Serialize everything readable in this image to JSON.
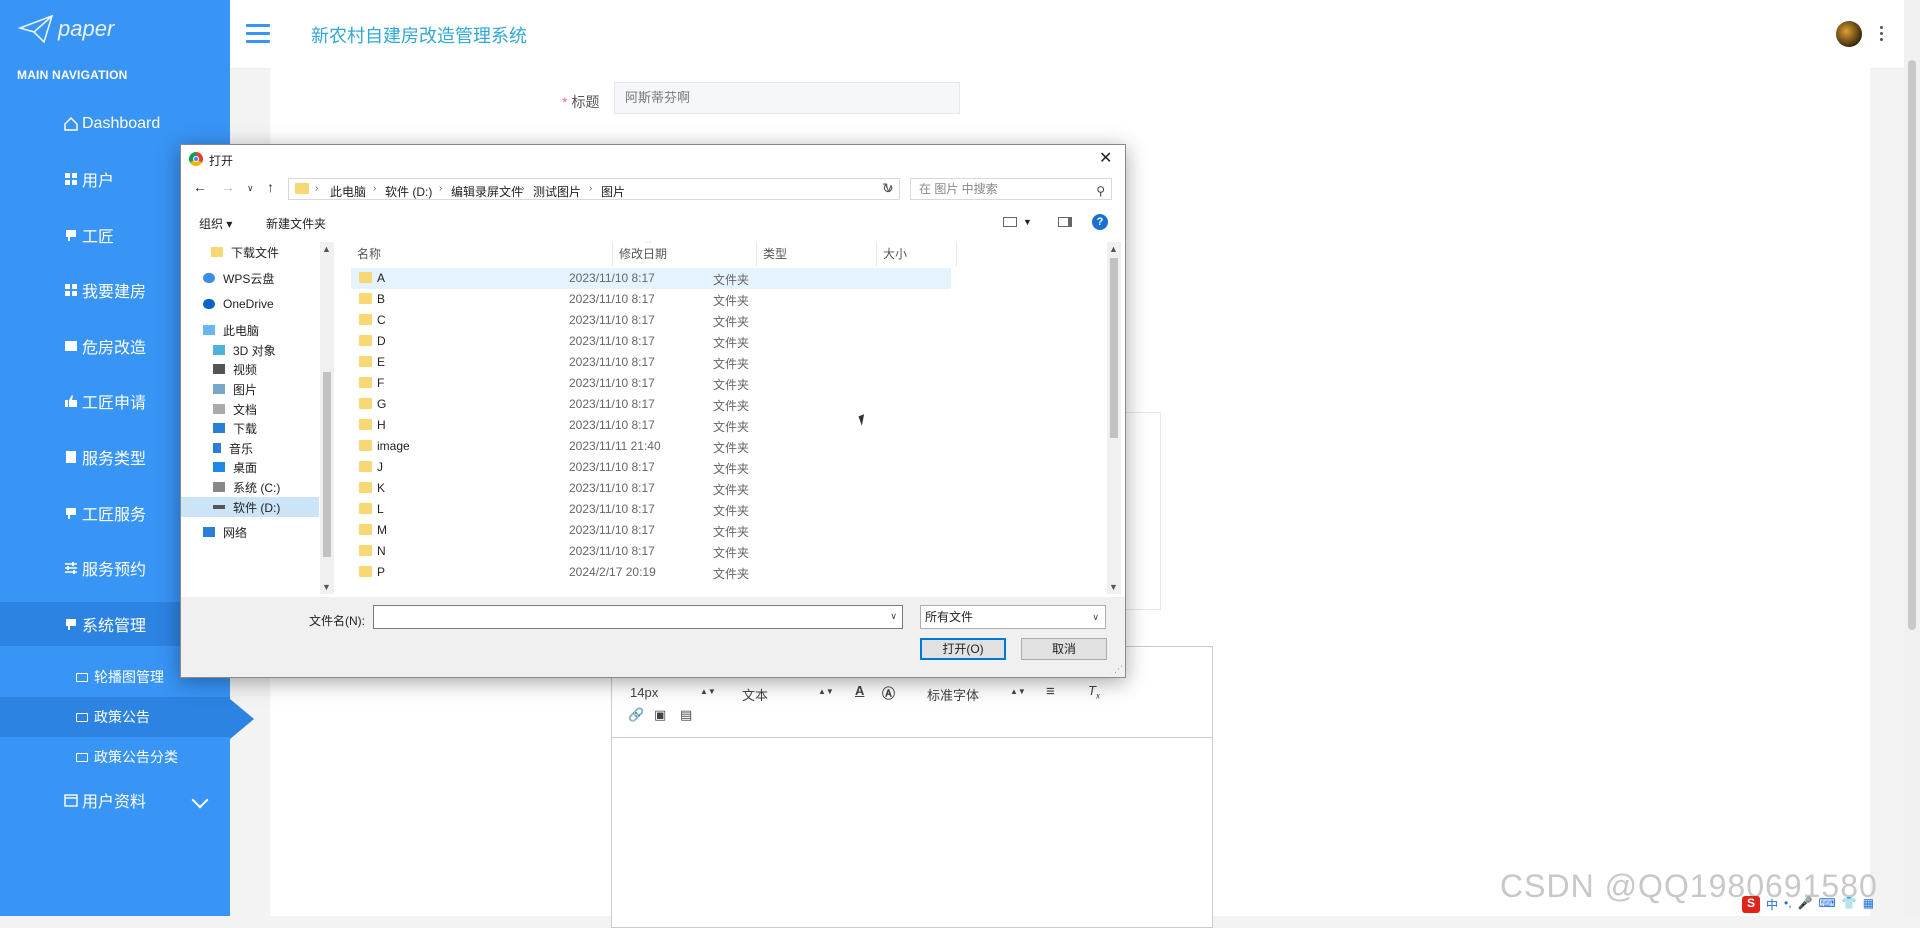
{
  "sidebar": {
    "logo_text": "paper",
    "section_label": "MAIN NAVIGATION",
    "items": [
      {
        "label": "Dashboard"
      },
      {
        "label": "用户"
      },
      {
        "label": "工匠"
      },
      {
        "label": "我要建房"
      },
      {
        "label": "危房改造"
      },
      {
        "label": "工匠申请"
      },
      {
        "label": "服务类型"
      },
      {
        "label": "工匠服务"
      },
      {
        "label": "服务预约"
      },
      {
        "label": "系统管理"
      }
    ],
    "sub_items": [
      {
        "label": "轮播图管理"
      },
      {
        "label": "政策公告"
      },
      {
        "label": "政策公告分类"
      }
    ],
    "bottom_item": {
      "label": "用户资料"
    }
  },
  "header": {
    "title": "新农村自建房改造管理系统"
  },
  "form": {
    "title_label": "标题",
    "title_value": "阿斯蒂芬啊"
  },
  "editor": {
    "font_size": "14px",
    "block_type": "文本",
    "font_family": "标准字体"
  },
  "dialog": {
    "title": "打开",
    "breadcrumb": [
      "此电脑",
      "软件 (D:)",
      "编辑录屏文件",
      "测试图片",
      "图片"
    ],
    "search_placeholder": "在 图片 中搜索",
    "organize_label": "组织",
    "new_folder_label": "新建文件夹",
    "nav_pane": [
      {
        "label": "下载文件"
      },
      {
        "label": "WPS云盘"
      },
      {
        "label": "OneDrive"
      },
      {
        "label": "此电脑"
      },
      {
        "label": "3D 对象"
      },
      {
        "label": "视频"
      },
      {
        "label": "图片"
      },
      {
        "label": "文档"
      },
      {
        "label": "下载"
      },
      {
        "label": "音乐"
      },
      {
        "label": "桌面"
      },
      {
        "label": "系统 (C:)"
      },
      {
        "label": "软件 (D:)"
      },
      {
        "label": "网络"
      }
    ],
    "columns": {
      "name": "名称",
      "date": "修改日期",
      "type": "类型",
      "size": "大小"
    },
    "files": [
      {
        "name": "A",
        "date": "2023/11/10 8:17",
        "type": "文件夹"
      },
      {
        "name": "B",
        "date": "2023/11/10 8:17",
        "type": "文件夹"
      },
      {
        "name": "C",
        "date": "2023/11/10 8:17",
        "type": "文件夹"
      },
      {
        "name": "D",
        "date": "2023/11/10 8:17",
        "type": "文件夹"
      },
      {
        "name": "E",
        "date": "2023/11/10 8:17",
        "type": "文件夹"
      },
      {
        "name": "F",
        "date": "2023/11/10 8:17",
        "type": "文件夹"
      },
      {
        "name": "G",
        "date": "2023/11/10 8:17",
        "type": "文件夹"
      },
      {
        "name": "H",
        "date": "2023/11/10 8:17",
        "type": "文件夹"
      },
      {
        "name": "image",
        "date": "2023/11/11 21:40",
        "type": "文件夹"
      },
      {
        "name": "J",
        "date": "2023/11/10 8:17",
        "type": "文件夹"
      },
      {
        "name": "K",
        "date": "2023/11/10 8:17",
        "type": "文件夹"
      },
      {
        "name": "L",
        "date": "2023/11/10 8:17",
        "type": "文件夹"
      },
      {
        "name": "M",
        "date": "2023/11/10 8:17",
        "type": "文件夹"
      },
      {
        "name": "N",
        "date": "2023/11/10 8:17",
        "type": "文件夹"
      },
      {
        "name": "P",
        "date": "2024/2/17 20:19",
        "type": "文件夹"
      }
    ],
    "filename_label": "文件名(N):",
    "filename_value": "",
    "filetype_value": "所有文件",
    "open_label": "打开(O)",
    "cancel_label": "取消"
  },
  "watermark": "CSDN @QQ1980691580",
  "tray": {
    "ime": "中"
  },
  "colors": {
    "sidebar": "#3894f5",
    "sidebar_active": "#2d83e2",
    "title": "#2fa8d5",
    "dialog_primary": "#0078d7"
  }
}
